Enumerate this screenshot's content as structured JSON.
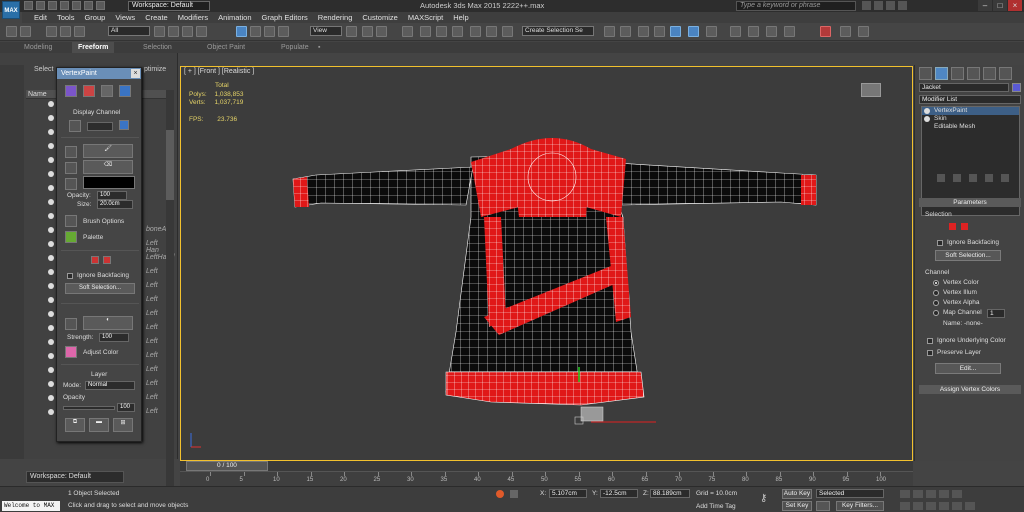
{
  "titlebar": {
    "logo": "MAX",
    "workspace": "Workspace: Default",
    "app_title": "Autodesk 3ds Max  2015      2222++.max",
    "search_placeholder": "Type a keyword or phrase"
  },
  "menu": [
    "Edit",
    "Tools",
    "Group",
    "Views",
    "Create",
    "Modifiers",
    "Animation",
    "Graph Editors",
    "Rendering",
    "Customize",
    "MAXScript",
    "Help"
  ],
  "toolbar": {
    "filter": "All",
    "ref_coord": "View",
    "selection_set": "Create Selection Se"
  },
  "ribbon": {
    "tabs": [
      "Modeling",
      "Freeform",
      "Selection",
      "Object Paint",
      "Populate"
    ],
    "active": "Freeform"
  },
  "scene_explorer": {
    "tabs": [
      "Select",
      "ptimize"
    ],
    "column": "Name",
    "rows": [
      "",
      "",
      "",
      "",
      "",
      "",
      "",
      "",
      "",
      "boneAr",
      "Left Han",
      "LeftHand",
      "Left",
      "Left",
      "Left",
      "Left",
      "Left",
      "Left",
      "Left",
      "Left",
      "Left",
      "Left",
      "Left"
    ]
  },
  "vertex_paint": {
    "title": "VertexPaint",
    "display_channel": "Display Channel",
    "opacity_label": "Opacity:",
    "opacity": "100",
    "size_label": "Size:",
    "size": "20.0cm",
    "brush_options": "Brush Options",
    "palette": "Palette",
    "ignore_backfacing": "Ignore Backfacing",
    "soft_selection": "Soft Selection...",
    "strength_label": "Strength:",
    "strength": "100",
    "adjust_color": "Adjust Color",
    "layer": "Layer",
    "mode_label": "Mode:",
    "mode": "Normal",
    "layer_opacity_label": "Opacity",
    "layer_opacity": "100"
  },
  "viewport": {
    "label": "[ + ] [Front ] [Realistic ]",
    "stats_header": "Total",
    "polys_label": "Polys:",
    "polys": "1,038,853",
    "verts_label": "Verts:",
    "verts": "1,037,719",
    "fps_label": "FPS:",
    "fps": "23.736"
  },
  "command_panel": {
    "object_name": "Jacket",
    "object_color": "#5a5ad6",
    "modifier_list": "Modifier List",
    "stack": [
      "VertexPaint",
      "Skin",
      "Editable Mesh"
    ],
    "parameters": "Parameters",
    "selection_label": "Selection",
    "ignore_backfacing": "Ignore Backfacing",
    "soft_selection": "Soft Selection...",
    "channel_label": "Channel",
    "channels": [
      "Vertex Color",
      "Vertex Illum",
      "Vertex Alpha",
      "Map Channel"
    ],
    "map_channel_value": "1",
    "name_label": "Name: -none-",
    "ignore_underlying": "Ignore Underlying Color",
    "preserve_layer": "Preserve Layer",
    "edit_btn": "Edit...",
    "assign_rollout": "Assign Vertex Colors"
  },
  "timeline": {
    "slider": "0 / 100",
    "ticks": [
      "0",
      "5",
      "10",
      "15",
      "20",
      "25",
      "30",
      "35",
      "40",
      "45",
      "50",
      "55",
      "60",
      "65",
      "70",
      "75",
      "80",
      "85",
      "90",
      "95",
      "100"
    ]
  },
  "status": {
    "workspace": "Workspace: Default",
    "selected_text": "1 Object Selected",
    "prompt": "Click and drag to select and move objects",
    "maxscript": "Welcome to MAX",
    "x_label": "X:",
    "x": "5.107cm",
    "y_label": "Y:",
    "y": "-12.5cm",
    "z_label": "Z:",
    "z": "88.189cm",
    "grid": "Grid = 10.0cm",
    "add_time_tag": "Add Time Tag",
    "auto_key": "Auto Key",
    "set_key": "Set Key",
    "selected_drop": "Selected",
    "key_filters": "Key Filters..."
  }
}
